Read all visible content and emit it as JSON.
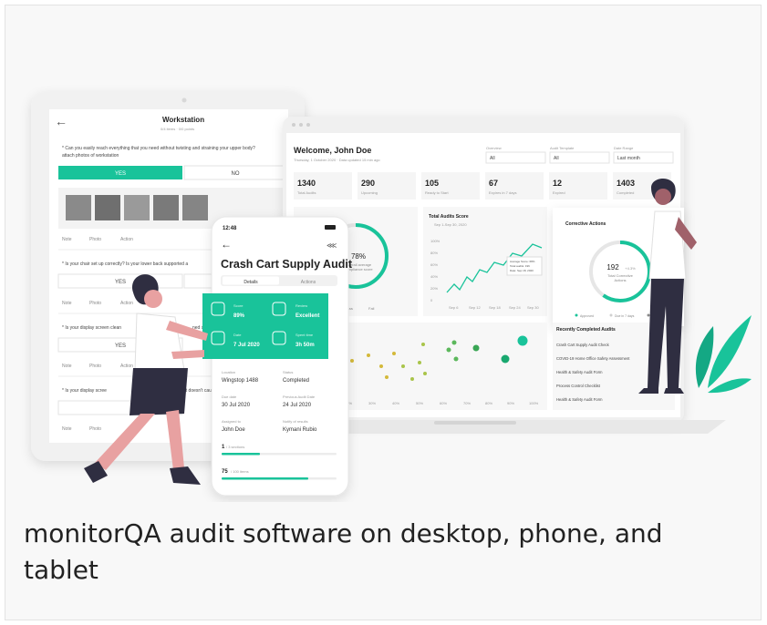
{
  "colors": {
    "accent": "#19c39a",
    "dark": "#2f2e41",
    "skin": "#e8a1a1",
    "panel": "#ffffff",
    "muted": "#9a9a9a"
  },
  "tablet": {
    "title": "Workstation",
    "subtitle": "0/4 items · 0/0 points",
    "q1": "* Can you easily reach everything that you need without twisting and straining your upper body?",
    "q1b": "attach photos of workstation",
    "yes": "YES",
    "no": "NO",
    "q2": "* Is your chair set up correctly? Is your lower back supported a",
    "q3": "* Is your display screen clean",
    "q3b": "ned so there is",
    "q4": "* Is your display scree",
    "q4b": "so it doesn't caus",
    "note": "Note",
    "photo": "Photo",
    "action": "Action"
  },
  "desktop": {
    "welcome": "Welcome, John Doe",
    "date": "Thursday, 1 October 2020 · Data updated 15 min ago",
    "filters": [
      {
        "label": "Overview",
        "value": "All"
      },
      {
        "label": "Audit Template",
        "value": "All"
      },
      {
        "label": "Date Range",
        "value": "Last month"
      }
    ],
    "stats": [
      {
        "value": "1340",
        "label": "Total Audits"
      },
      {
        "value": "290",
        "label": "Upcoming"
      },
      {
        "value": "105",
        "label": "Ready to Start"
      },
      {
        "value": "67",
        "label": "Expires in 7 days"
      },
      {
        "value": "12",
        "label": "Expired"
      },
      {
        "value": "1403",
        "label": "Completed"
      }
    ],
    "score_pct": "78%",
    "score_label1": "Overall average",
    "score_label2": "compliance score",
    "pass": "Pass",
    "fail": "Fail",
    "total_title": "Total Audits Score",
    "total_sub": "Sep 1-Sep 30, 2020",
    "y_ticks": [
      "100%",
      "80%",
      "60%",
      "40%",
      "20%",
      "0"
    ],
    "x_ticks": [
      "Sep 6",
      "Sep 12",
      "Sep 18",
      "Sep 24",
      "Sep 30"
    ],
    "tooltip": [
      "Average Score: 68%",
      "Total audits: 196",
      "Date: Sep 18, 2020"
    ],
    "corrective_title": "Corrective Actions",
    "corrective_value": "192",
    "corrective_delta": "+4.3%",
    "corrective_label1": "Total Corrective",
    "corrective_label2": "Actions",
    "legend": [
      "Approved",
      "Due in 7 days",
      "Rejected"
    ],
    "scatter_ticks": [
      "20%",
      "30%",
      "40%",
      "50%",
      "60%",
      "70%",
      "80%",
      "90%",
      "100%"
    ],
    "recent_title": "Recently Completed Audits",
    "recent": [
      "Crash Cart Supply Audit Check",
      "COVID-19 Home Office Safety Assessment",
      "Health & Safety Audit Form",
      "Process Control Checklist",
      "Health & Safety Audit Form"
    ]
  },
  "phone": {
    "time": "12:48",
    "title": "Crash Cart Supply Audit",
    "tab_details": "Details",
    "tab_actions": "Actions",
    "score_label": "Score",
    "score_value": "89%",
    "review_label": "Review",
    "review_value": "Excellent",
    "date_label": "Date",
    "date_value": "7 Jul 2020",
    "time_label": "Spent time",
    "time_value": "3h 50m",
    "location_label": "Location",
    "location_value": "Wingstop 1488",
    "status_label": "Status",
    "status_value": "Completed",
    "due_label": "Due date",
    "due_value": "30 Jul 2020",
    "prev_label": "Previous Audit Date",
    "prev_value": "24 Jul 2020",
    "assigned_label": "Assigned to",
    "assigned_value": "John Doe",
    "notify_label": "Notify of results",
    "notify_value": "Kymani Rubio",
    "progress1_value": "1",
    "progress1_total": "/ 3 sections",
    "progress2_value": "75",
    "progress2_total": "/ 100 items"
  },
  "caption": "monitorQA audit software on desktop, phone, and tablet"
}
